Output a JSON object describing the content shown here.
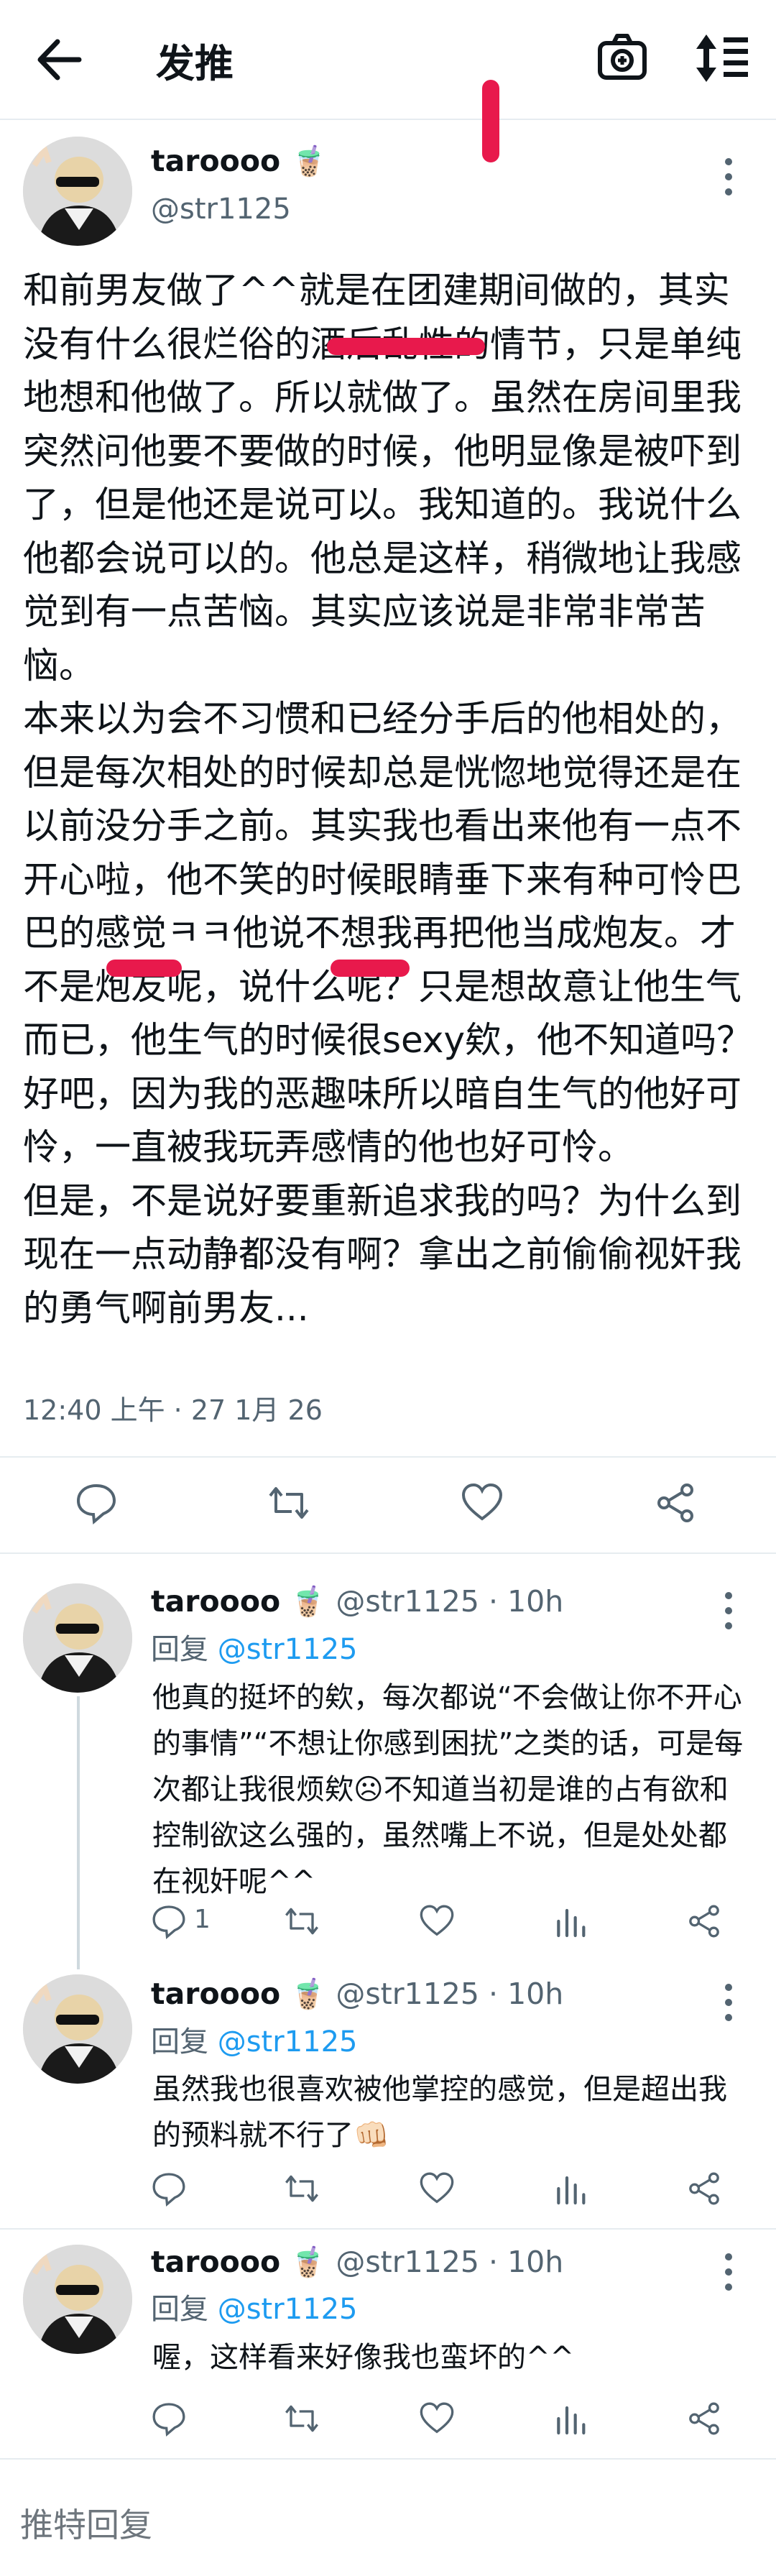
{
  "header": {
    "title": "发推"
  },
  "tweet": {
    "display_name": "taroooo",
    "name_emoji": "🧋",
    "handle": "@str1125",
    "body": "和前男友做了^^就是在团建期间做的，其实没有什么很烂俗的酒后乱性的情节，只是单纯地想和他做了。所以就做了。虽然在房间里我突然问他要不要做的时候，他明显像是被吓到了，但是他还是说可以。我知道的。我说什么他都会说可以的。他总是这样，稍微地让我感觉到有一点苦恼。其实应该说是非常非常苦恼。\n本来以为会不习惯和已经分手后的他相处的，但是每次相处的时候却总是恍惚地觉得还是在以前没分手之前。其实我也看出来他有一点不开心啦，他不笑的时候眼睛垂下来有种可怜巴巴的感觉ㅋㅋ他说不想我再把他当成炮友。才不是炮友呢，说什么呢？只是想故意让他生气而已，他生气的时候很sexy欸，他不知道吗？\n好吧，因为我的恶趣味所以暗自生气的他好可怜，一直被我玩弄感情的他也好可怜。\n但是，不是说好要重新追求我的吗？为什么到现在一点动静都没有啊？拿出之前偷偷视奸我的勇气啊前男友...",
    "timestamp": "12:40 上午 · 27 1月 26"
  },
  "replies": [
    {
      "display_name": "taroooo",
      "name_emoji": "🧋",
      "handle": "@str1125",
      "time": "10h",
      "reply_prefix": "回复",
      "reply_to": "@str1125",
      "text": "他真的挺坏的欸，每次都说“不会做让你不开心的事情”“不想让你感到困扰”之类的话，可是每次都让我很烦欸☹不知道当初是谁的占有欲和控制欲这么强的，虽然嘴上不说，但是处处都在视奸呢^^",
      "reply_count": "1"
    },
    {
      "display_name": "taroooo",
      "name_emoji": "🧋",
      "handle": "@str1125",
      "time": "10h",
      "reply_prefix": "回复",
      "reply_to": "@str1125",
      "text": "虽然我也很喜欢被他掌控的感觉，但是超出我的预料就不行了👊🏻",
      "reply_count": ""
    },
    {
      "display_name": "taroooo",
      "name_emoji": "🧋",
      "handle": "@str1125",
      "time": "10h",
      "reply_prefix": "回复",
      "reply_to": "@str1125",
      "text": "喔，这样看来好像我也蛮坏的^^",
      "reply_count": ""
    }
  ],
  "reply_bar": {
    "placeholder": "推特回复"
  },
  "colors": {
    "accent": "#1d9bf0",
    "redaction": "#e8194c",
    "secondary_text": "#536471"
  }
}
